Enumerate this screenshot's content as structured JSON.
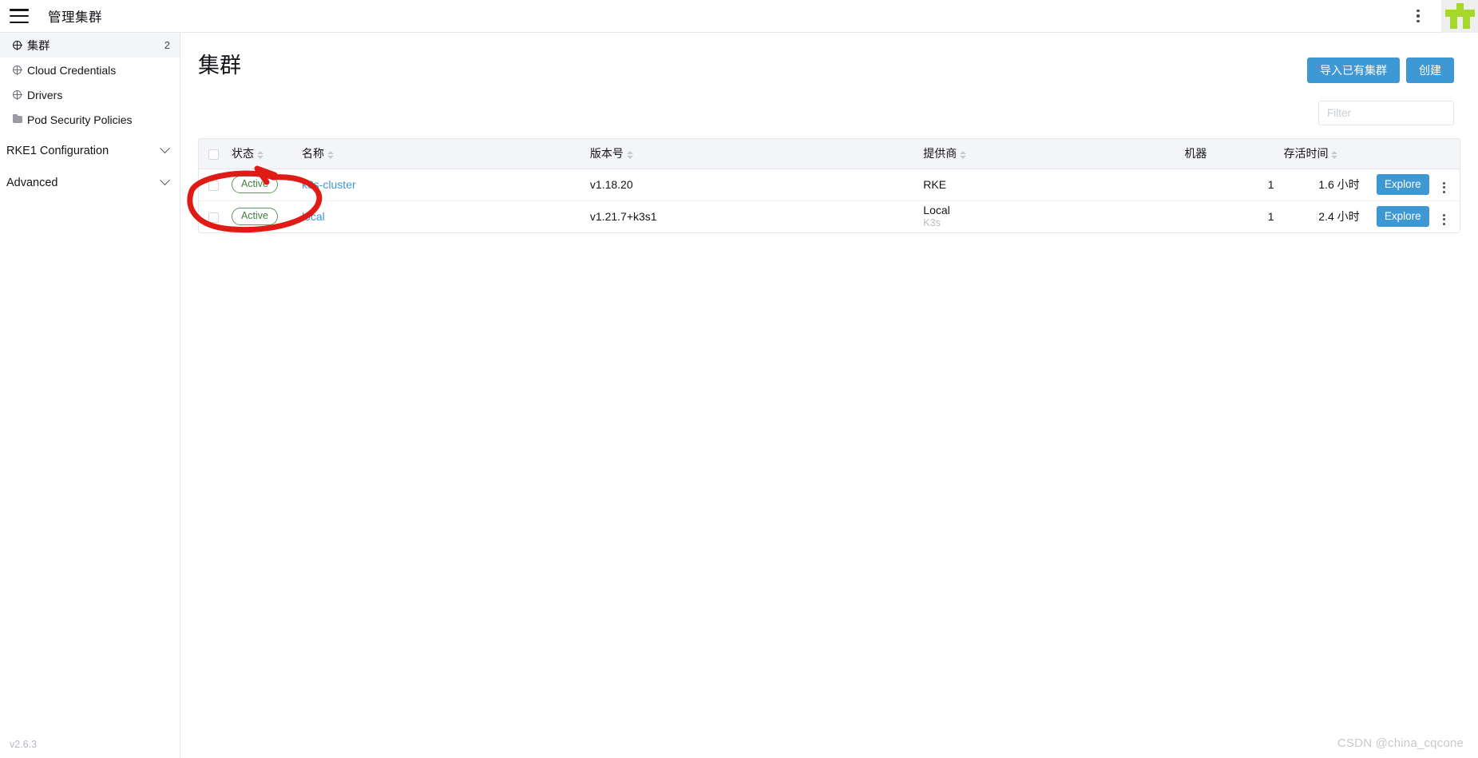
{
  "topbar": {
    "menu_icon": "hamburger-icon",
    "title": "管理集群",
    "kebab_icon": "vertical-dots-icon",
    "logo_name": "rancher-logo",
    "logo_color": "#a6d82b"
  },
  "sidebar": {
    "items": [
      {
        "label": "集群",
        "icon": "globe-icon",
        "count": "2",
        "active": true
      },
      {
        "label": "Cloud Credentials",
        "icon": "globe-icon",
        "count": "",
        "active": false
      },
      {
        "label": "Drivers",
        "icon": "globe-icon",
        "count": "",
        "active": false
      },
      {
        "label": "Pod Security Policies",
        "icon": "folder-icon",
        "count": "",
        "active": false
      }
    ],
    "groups": [
      {
        "label": "RKE1 Configuration",
        "icon": "chevron-down-icon"
      },
      {
        "label": "Advanced",
        "icon": "chevron-down-icon"
      }
    ],
    "version": "v2.6.3"
  },
  "main": {
    "page_title": "集群",
    "actions": {
      "import_label": "导入已有集群",
      "create_label": "创建"
    },
    "filter": {
      "placeholder": "Filter",
      "value": ""
    },
    "table": {
      "headers": [
        {
          "label": "状态",
          "sortable": true
        },
        {
          "label": "名称",
          "sortable": true
        },
        {
          "label": "版本号",
          "sortable": true
        },
        {
          "label": "提供商",
          "sortable": true
        },
        {
          "label": "机器",
          "sortable": false
        },
        {
          "label": "存活时间",
          "sortable": true
        }
      ],
      "rows": [
        {
          "state": "Active",
          "name": "k8s-cluster",
          "version": "v1.18.20",
          "provider": "RKE",
          "provider_sub": "",
          "machines": "1",
          "age": "1.6 小时",
          "explore_label": "Explore",
          "kebab_icon": "vertical-dots-icon"
        },
        {
          "state": "Active",
          "name": "local",
          "version": "v1.21.7+k3s1",
          "provider": "Local",
          "provider_sub": "K3s",
          "machines": "1",
          "age": "2.4 小时",
          "explore_label": "Explore",
          "kebab_icon": "vertical-dots-icon"
        }
      ]
    }
  },
  "annotation": {
    "shape": "red-ellipse-with-arrow",
    "color": "#e01b16"
  },
  "watermark": "CSDN @china_cqcone",
  "colors": {
    "accent_blue": "#3d98d3",
    "brand_green": "#a6d82b",
    "active_green": "#5d995d",
    "header_bg": "#f4f5f8",
    "border": "#e4e6ea"
  }
}
